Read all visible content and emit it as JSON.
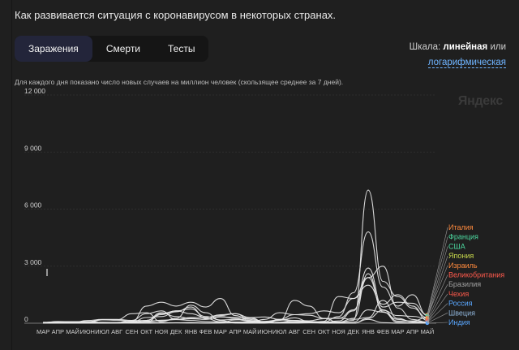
{
  "header": {
    "title": "Как развивается ситуация с коронавирусом в некоторых странах.",
    "tabs": [
      {
        "label": "Заражения",
        "active": true
      },
      {
        "label": "Смерти",
        "active": false
      },
      {
        "label": "Тесты",
        "active": false
      }
    ],
    "scale_prefix": "Шкала:",
    "scale_current": "линейная",
    "scale_or": "или",
    "scale_link": "логарифмическая",
    "watermark": "Яндекс"
  },
  "chart_data": {
    "type": "line",
    "subtitle": "Для каждого дня показано число новых случаев на миллион человек (скользящее среднее за 7 дней).",
    "title": "",
    "xlabel": "",
    "ylabel": "",
    "ylim": [
      0,
      12000
    ],
    "yticks": [
      0,
      3000,
      6000,
      9000,
      12000
    ],
    "ytick_labels": [
      "0",
      "3 000",
      "6 000",
      "9 000",
      "12 000"
    ],
    "xtick_labels": [
      "МАР",
      "АПР",
      "МАЙ",
      "ИЮН",
      "ИЮЛ",
      "АВГ",
      "СЕН",
      "ОКТ",
      "НОЯ",
      "ДЕК",
      "ЯНВ",
      "ФЕВ",
      "МАР",
      "АПР",
      "МАЙ",
      "ИЮН",
      "ИЮЛ",
      "АВГ",
      "СЕН",
      "ОКТ",
      "НОЯ",
      "ДЕК",
      "ЯНВ",
      "ФЕВ",
      "МАР",
      "АПР",
      "МАЙ"
    ],
    "x_months": [
      "2020-03",
      "2020-04",
      "2020-05",
      "2020-06",
      "2020-07",
      "2020-08",
      "2020-09",
      "2020-10",
      "2020-11",
      "2020-12",
      "2021-01",
      "2021-02",
      "2021-03",
      "2021-04",
      "2021-05",
      "2021-06",
      "2021-07",
      "2021-08",
      "2021-09",
      "2021-10",
      "2021-11",
      "2021-12",
      "2022-01",
      "2022-02",
      "2022-03",
      "2022-04",
      "2022-05"
    ],
    "line_color": "#e8e8e8",
    "series": [
      {
        "name": "Италия",
        "color": "#ff8a3d",
        "values": [
          50,
          60,
          10,
          5,
          5,
          10,
          30,
          150,
          550,
          350,
          250,
          200,
          350,
          250,
          120,
          30,
          40,
          90,
          70,
          40,
          120,
          650,
          2900,
          850,
          1100,
          1050,
          450
        ]
      },
      {
        "name": "Франция",
        "color": "#4cd9a0",
        "values": [
          40,
          70,
          10,
          10,
          10,
          40,
          150,
          500,
          650,
          200,
          300,
          300,
          450,
          500,
          200,
          50,
          150,
          280,
          90,
          70,
          350,
          1600,
          4800,
          1900,
          900,
          1500,
          400
        ]
      },
      {
        "name": "США",
        "color": "#4cd9a0",
        "values": [
          30,
          90,
          80,
          80,
          180,
          160,
          110,
          150,
          450,
          650,
          750,
          350,
          170,
          200,
          100,
          40,
          200,
          450,
          420,
          250,
          250,
          700,
          2400,
          700,
          110,
          120,
          300
        ]
      },
      {
        "name": "Япония",
        "color": "#c8d94c",
        "values": [
          1,
          2,
          3,
          1,
          5,
          8,
          5,
          4,
          12,
          25,
          40,
          10,
          8,
          25,
          40,
          12,
          50,
          150,
          60,
          5,
          1,
          2,
          250,
          680,
          400,
          360,
          250
        ]
      },
      {
        "name": "Израиль",
        "color": "#ff8a3d",
        "values": [
          10,
          60,
          5,
          20,
          180,
          180,
          500,
          550,
          80,
          250,
          950,
          550,
          150,
          10,
          2,
          5,
          150,
          1200,
          900,
          250,
          50,
          150,
          7000,
          2200,
          1400,
          800,
          300
        ]
      },
      {
        "name": "Великобритания",
        "color": "#ff5a4c",
        "values": [
          20,
          80,
          40,
          15,
          10,
          15,
          50,
          300,
          350,
          600,
          850,
          250,
          80,
          40,
          40,
          200,
          550,
          450,
          500,
          650,
          550,
          1300,
          2000,
          1000,
          1500,
          900,
          150
        ]
      },
      {
        "name": "Бразилия",
        "color": "#a0a0a0",
        "values": [
          1,
          10,
          40,
          140,
          200,
          200,
          150,
          120,
          130,
          200,
          230,
          210,
          330,
          300,
          300,
          330,
          200,
          150,
          80,
          50,
          40,
          60,
          700,
          580,
          200,
          100,
          70
        ]
      },
      {
        "name": "Чехия",
        "color": "#ff5a4c",
        "values": [
          5,
          20,
          10,
          5,
          15,
          20,
          80,
          900,
          1100,
          900,
          1100,
          850,
          1300,
          400,
          150,
          20,
          10,
          10,
          20,
          100,
          1400,
          1300,
          2400,
          3000,
          800,
          200,
          50
        ]
      },
      {
        "name": "Россия",
        "color": "#5aa7ff",
        "values": [
          1,
          10,
          60,
          60,
          45,
          35,
          35,
          80,
          160,
          190,
          150,
          90,
          70,
          60,
          60,
          100,
          170,
          140,
          130,
          240,
          270,
          200,
          300,
          1200,
          250,
          70,
          30
        ]
      },
      {
        "name": "Швеция",
        "color": "#8fb4d9",
        "values": [
          10,
          50,
          60,
          90,
          40,
          20,
          20,
          60,
          500,
          650,
          500,
          300,
          400,
          500,
          300,
          50,
          30,
          60,
          70,
          40,
          60,
          250,
          2600,
          600,
          50,
          20,
          10
        ]
      },
      {
        "name": "Индия",
        "color": "#5aa7ff",
        "values": [
          0,
          1,
          3,
          7,
          20,
          40,
          65,
          50,
          30,
          20,
          12,
          9,
          20,
          170,
          250,
          60,
          30,
          25,
          20,
          12,
          8,
          6,
          200,
          30,
          5,
          2,
          2
        ]
      }
    ]
  }
}
